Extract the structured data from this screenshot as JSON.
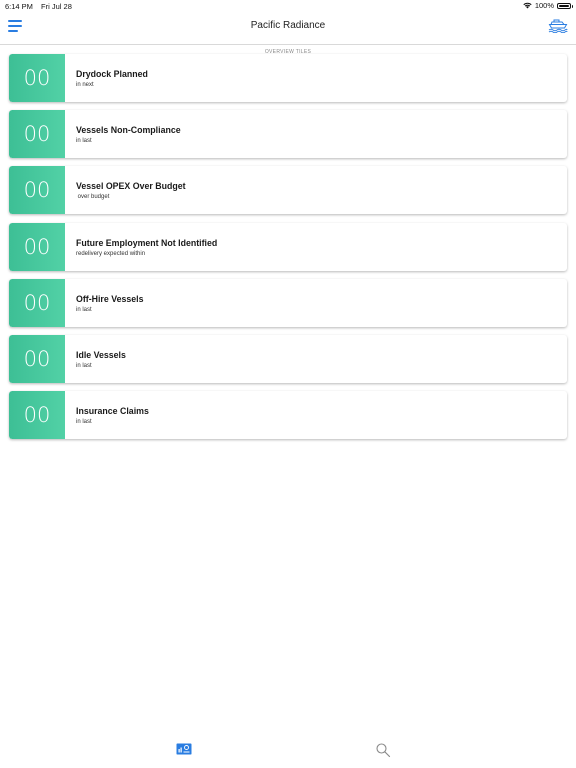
{
  "status_bar": {
    "time": "6:14 PM",
    "date": "Fri Jul 28",
    "battery": "100%"
  },
  "nav": {
    "title": "Pacific Radiance",
    "left_icon": "hamburger-menu-icon",
    "right_icon": "ship-icon"
  },
  "section_label": "OVERVIEW TILES",
  "tiles": [
    {
      "count": "00",
      "title": "Drydock Planned",
      "subtitle": "in next"
    },
    {
      "count": "00",
      "title": "Vessels Non-Compliance",
      "subtitle": "in last"
    },
    {
      "count": "00",
      "title": "Vessel OPEX Over Budget",
      "subtitle": " over budget"
    },
    {
      "count": "00",
      "title": "Future Employment Not Identified",
      "subtitle": "redelivery expected within"
    },
    {
      "count": "00",
      "title": "Off-Hire Vessels",
      "subtitle": "in last"
    },
    {
      "count": "00",
      "title": "Idle Vessels",
      "subtitle": "in last"
    },
    {
      "count": "00",
      "title": "Insurance Claims",
      "subtitle": "in last"
    }
  ],
  "tab_bar": {
    "items": [
      {
        "icon": "dashboard-icon"
      },
      {
        "icon": "search-icon"
      }
    ]
  },
  "colors": {
    "accent": "#2a7de1",
    "tile_green": "#46c79c",
    "background": "#ffffff"
  }
}
